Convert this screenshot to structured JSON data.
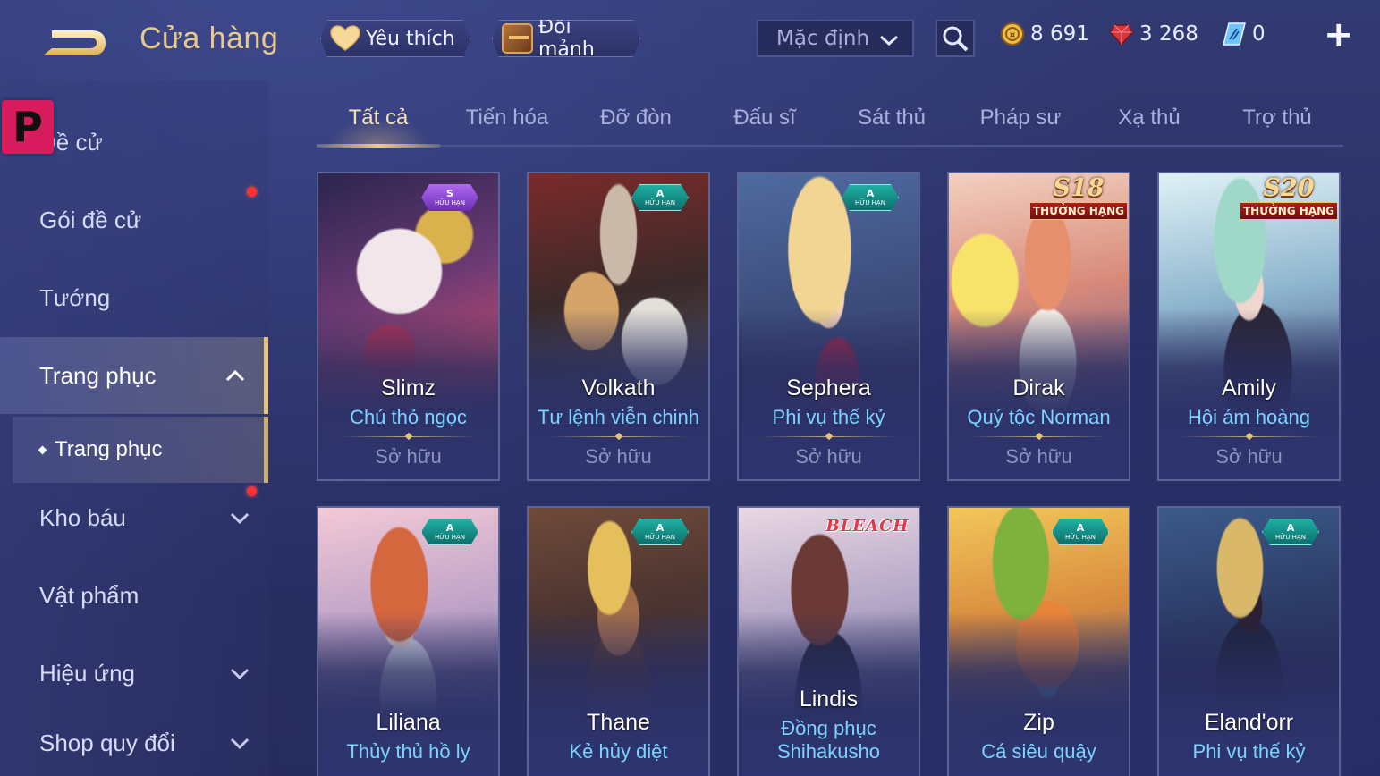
{
  "header": {
    "title": "Cửa hàng",
    "favorites_label": "Yêu thích",
    "exchange_label": "Đổi mảnh",
    "sort_value": "Mặc định"
  },
  "currencies": {
    "gold": "8 691",
    "ruby": "3 268",
    "voucher": "0"
  },
  "sidebar": {
    "items": [
      {
        "label": "Đề cử"
      },
      {
        "label": "Gói đề cử"
      },
      {
        "label": "Tướng"
      },
      {
        "label": "Trang phục"
      },
      {
        "label": "Trang phục"
      },
      {
        "label": "Kho báu"
      },
      {
        "label": "Vật phẩm"
      },
      {
        "label": "Hiệu ứng"
      },
      {
        "label": "Shop quy đổi"
      }
    ]
  },
  "tabs": [
    {
      "label": "Tất cả"
    },
    {
      "label": "Tiến hóa"
    },
    {
      "label": "Đỡ đòn"
    },
    {
      "label": "Đấu sĩ"
    },
    {
      "label": "Sát thủ"
    },
    {
      "label": "Pháp sư"
    },
    {
      "label": "Xạ thủ"
    },
    {
      "label": "Trợ thủ"
    }
  ],
  "cards": [
    {
      "hero": "Slimz",
      "skin": "Chú thỏ ngọc",
      "status": "Sở hữu",
      "badge_tier": "S",
      "badge_text": "HỮU HẠN"
    },
    {
      "hero": "Volkath",
      "skin": "Tư lệnh viễn chinh",
      "status": "Sở hữu",
      "badge_tier": "A",
      "badge_text": "HỮU HẠN"
    },
    {
      "hero": "Sephera",
      "skin": "Phi vụ thế kỷ",
      "status": "Sở hữu",
      "badge_tier": "A",
      "badge_text": "HỮU HẠN"
    },
    {
      "hero": "Dirak",
      "skin": "Quý tộc Norman",
      "status": "Sở hữu",
      "season": "S18",
      "season_text": "THƯỞNG HẠNG"
    },
    {
      "hero": "Amily",
      "skin": "Hội ám hoàng",
      "status": "Sở hữu",
      "season": "S20",
      "season_text": "THƯỞNG HẠNG"
    },
    {
      "hero": "Liliana",
      "skin": "Thủy thủ hồ ly",
      "badge_tier": "A",
      "badge_text": "HỮU HẠN"
    },
    {
      "hero": "Thane",
      "skin": "Kẻ hủy diệt",
      "badge_tier": "A",
      "badge_text": "HỮU HẠN"
    },
    {
      "hero": "Lindis",
      "skin_line1": "Đồng phục",
      "skin_line2": "Shihakusho",
      "collab": "BLEACH"
    },
    {
      "hero": "Zip",
      "skin": "Cá siêu quậy",
      "badge_tier": "A",
      "badge_text": "HỮU HẠN"
    },
    {
      "hero": "Eland'orr",
      "skin": "Phi vụ thế kỷ",
      "badge_tier": "A",
      "badge_text": "HỮU HẠN"
    }
  ],
  "colors": {
    "accent_gold": "#e7c98a",
    "skin_name_blue": "#7cd3ff",
    "background": "#2b3164",
    "notify_red": "#ff3030"
  },
  "icons": [
    "back-arrow-icon",
    "heart-icon",
    "chest-icon",
    "chevron-down-icon",
    "search-icon",
    "gold-coin-icon",
    "ruby-icon",
    "voucher-icon",
    "plus-icon",
    "chevron-up-icon",
    "p-logo-icon"
  ]
}
